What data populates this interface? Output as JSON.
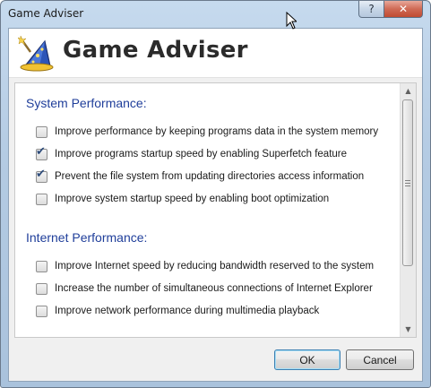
{
  "window": {
    "title": "Game Adviser",
    "help_label": "?",
    "close_label": "✕"
  },
  "header": {
    "title": "Game Adviser",
    "logo_icon": "wizard-hat-icon"
  },
  "sections": [
    {
      "title": "System Performance:",
      "options": [
        {
          "label": "Improve performance by keeping programs data in the system memory",
          "checked": false
        },
        {
          "label": "Improve programs startup speed by enabling Superfetch feature",
          "checked": true
        },
        {
          "label": "Prevent the file system from updating directories access information",
          "checked": true
        },
        {
          "label": "Improve system startup speed by enabling boot optimization",
          "checked": false
        }
      ]
    },
    {
      "title": "Internet Performance:",
      "options": [
        {
          "label": "Improve Internet speed by reducing bandwidth reserved to the system",
          "checked": false
        },
        {
          "label": "Increase the number of simultaneous connections of Internet Explorer",
          "checked": false
        },
        {
          "label": "Improve network performance during multimedia playback",
          "checked": false
        }
      ]
    }
  ],
  "buttons": {
    "ok": "OK",
    "cancel": "Cancel"
  },
  "colors": {
    "section_title": "#1f3e9a",
    "close_button": "#c04a31"
  }
}
